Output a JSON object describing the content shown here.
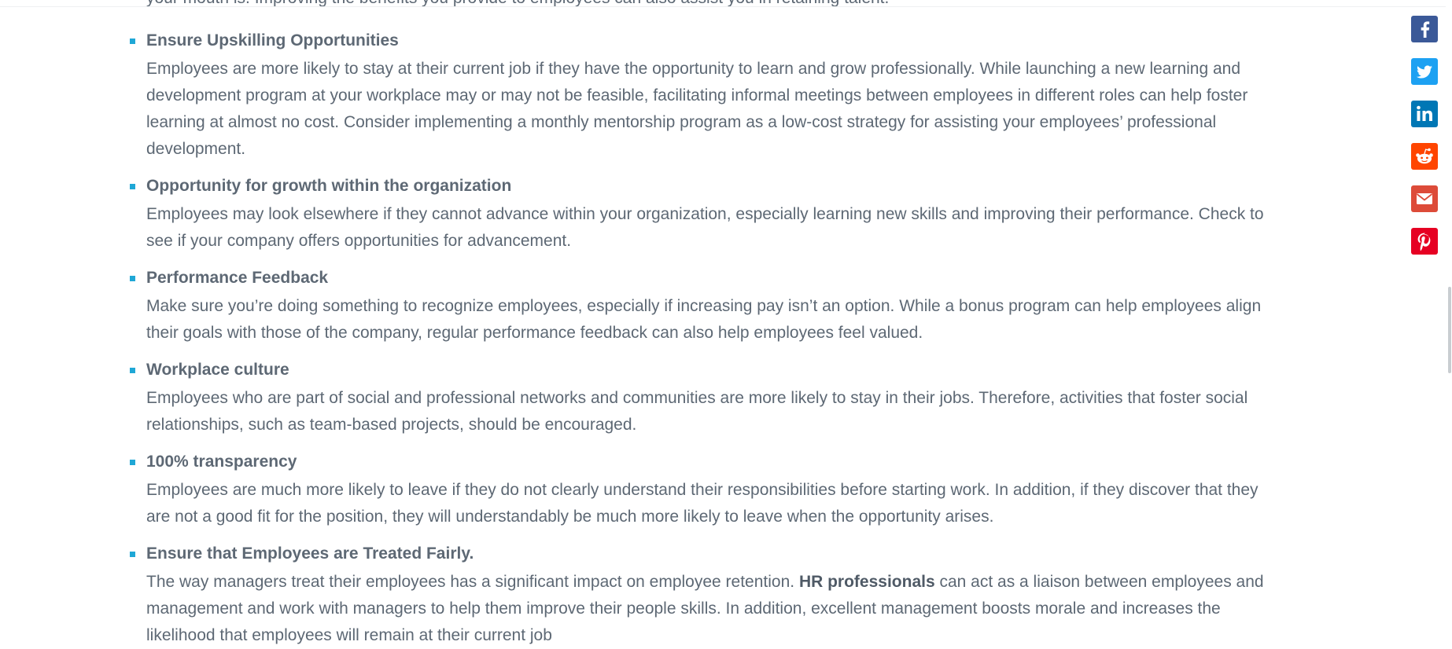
{
  "top_fragment": "your mouth is. Improving the benefits you provide to employees can also assist you in retaining talent.",
  "tips": [
    {
      "title": "Ensure Upskilling Opportunities",
      "lines": [
        "Employees are more likely to stay at their current job if they have the opportunity to learn and grow professionally. While launching a new learning and",
        "development program at your workplace may or may not be feasible, facilitating informal meetings between employees in different roles can help foster",
        "learning at almost no cost. Consider implementing a monthly mentorship program as a low-cost strategy for assisting your employees’ professional",
        "development."
      ]
    },
    {
      "title": "Opportunity for growth within the organization",
      "lines": [
        "Employees may look elsewhere if they cannot advance within your organization, especially learning new skills and improving their performance. Check to",
        "see if your company offers opportunities for advancement."
      ]
    },
    {
      "title": "Performance Feedback",
      "lines": [
        "Make sure you’re doing something to recognize employees, especially if increasing pay isn’t an option. While a bonus program can help employees align",
        "their goals with those of the company, regular performance feedback can also help employees feel valued."
      ]
    },
    {
      "title": "Workplace culture",
      "lines": [
        "Employees who are part of social and professional networks and communities are more likely to stay in their jobs. Therefore, activities that foster social",
        "relationships, such as team-based projects, should be encouraged."
      ]
    },
    {
      "title": "100% transparency",
      "lines": [
        "Employees are much more likely to leave if they do not clearly understand their responsibilities before starting work. In addition, if they discover that they",
        "are not a good fit for the position, they will understandably be much more likely to leave when the opportunity arises."
      ]
    },
    {
      "title": "Ensure that Employees are Treated Fairly.",
      "line1_before": "The way managers treat their employees has a significant impact on employee retention. ",
      "line1_bold": "HR professionals",
      "line1_after": " can act as a liaison between employees and",
      "lines_rest": [
        "management and work with managers to help them improve their people skills. In addition, excellent management boosts morale and increases the",
        "likelihood that employees will remain at their current job"
      ]
    }
  ],
  "share": [
    {
      "name": "facebook",
      "icon": "facebook-icon",
      "color": "#3b5998"
    },
    {
      "name": "twitter",
      "icon": "twitter-icon",
      "color": "#1da1f2"
    },
    {
      "name": "linkedin",
      "icon": "linkedin-icon",
      "color": "#0077b5"
    },
    {
      "name": "reddit",
      "icon": "reddit-icon",
      "color": "#ff4500"
    },
    {
      "name": "email",
      "icon": "email-icon",
      "color": "#dd4b39"
    },
    {
      "name": "pinterest",
      "icon": "pinterest-icon",
      "color": "#e60023"
    }
  ],
  "colors": {
    "text": "#5d6874",
    "bullet": "#1fa7d6"
  }
}
